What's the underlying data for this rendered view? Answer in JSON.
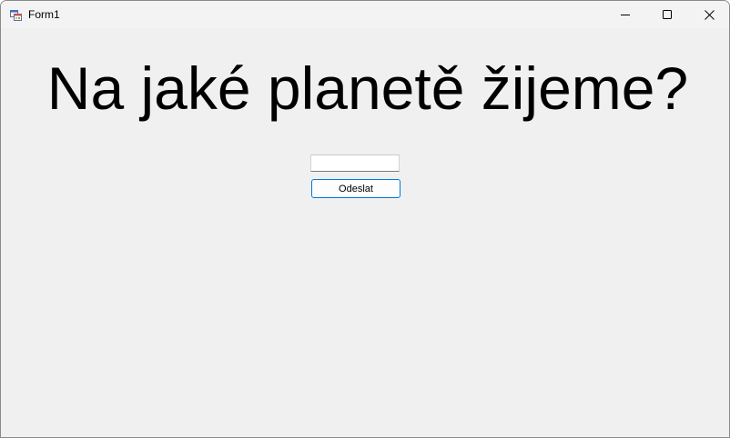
{
  "window": {
    "title": "Form1",
    "app_icon": "winforms-app-icon",
    "controls": {
      "minimize_icon": "minimize-icon",
      "maximize_icon": "maximize-icon",
      "close_icon": "close-icon"
    }
  },
  "form": {
    "question": "Na jaké planetě žijeme?",
    "answer_input": {
      "value": "",
      "placeholder": ""
    },
    "submit_label": "Odeslat"
  },
  "colors": {
    "client_background": "#f0f0f0",
    "titlebar_background": "#f3f3f3",
    "button_focus_border": "#0078d7"
  }
}
